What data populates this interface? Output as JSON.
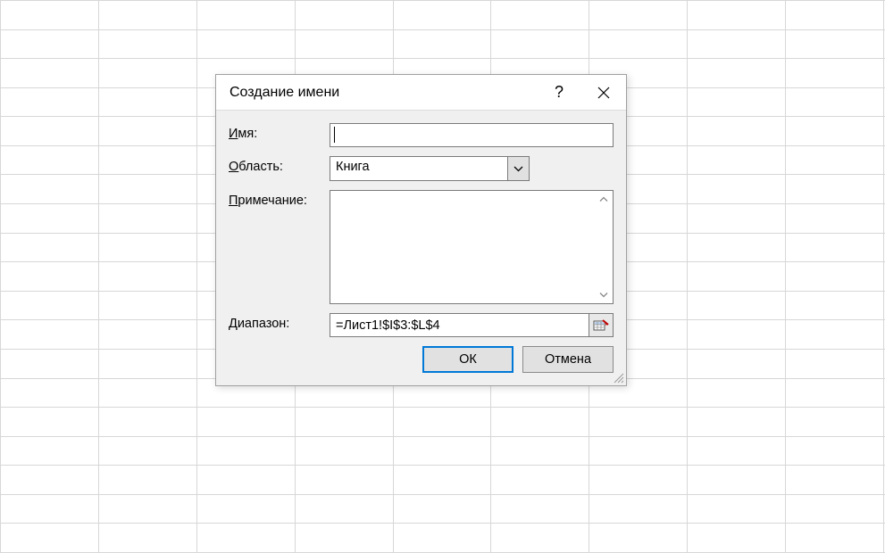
{
  "dialog": {
    "title": "Создание имени",
    "help_icon": "?",
    "close_icon": "✕",
    "labels": {
      "name_prefix": "И",
      "name_rest": "мя:",
      "scope_prefix": "О",
      "scope_rest": "бласть:",
      "comment_prefix": "П",
      "comment_rest": "римечание:",
      "range_prefix": "Д",
      "range_rest": "иапазон:"
    },
    "values": {
      "name": "",
      "scope": "Книга",
      "comment": "",
      "range": "=Лист1!$I$3:$L$4"
    },
    "buttons": {
      "ok": "ОК",
      "cancel": "Отмена"
    }
  }
}
